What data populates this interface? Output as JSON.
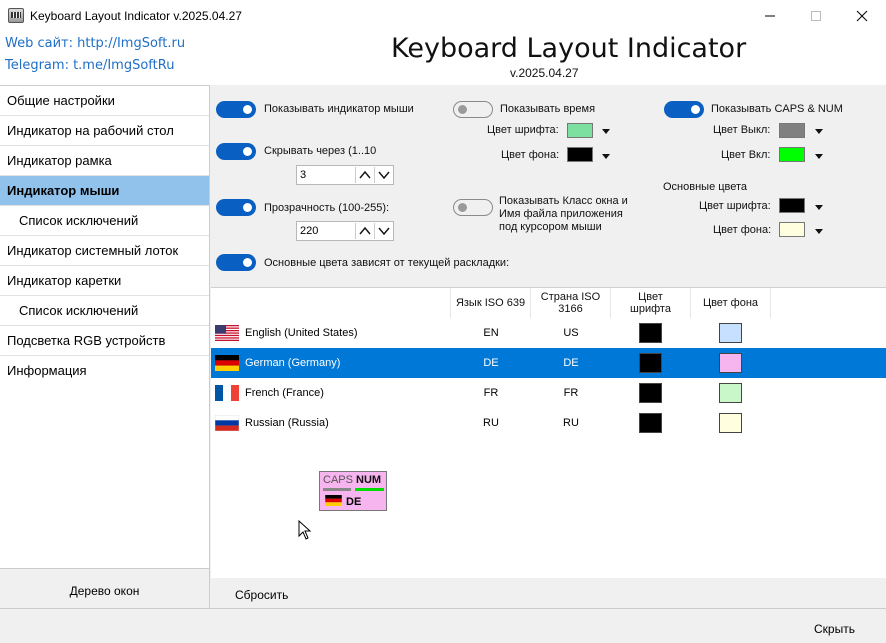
{
  "window": {
    "title": "Keyboard Layout Indicator v.2025.04.27",
    "minimize_icon": "minimize-icon",
    "maximize_icon": "maximize-icon",
    "close_icon": "close-icon"
  },
  "header": {
    "web_link": "Web сайт: http://ImgSoft.ru",
    "telegram_link": "Telegram: t.me/ImgSoftRu",
    "title": "Keyboard Layout Indicator",
    "version": "v.2025.04.27"
  },
  "sidebar": {
    "items": [
      {
        "label": "Общие настройки"
      },
      {
        "label": "Индикатор на рабочий стол"
      },
      {
        "label": "Индикатор рамка"
      },
      {
        "label": "Индикатор мыши"
      },
      {
        "label": "Список исключений"
      },
      {
        "label": "Индикатор системный лоток"
      },
      {
        "label": "Индикатор каретки"
      },
      {
        "label": "Список исключений"
      },
      {
        "label": "Подсветка RGB устройств"
      },
      {
        "label": "Информация"
      }
    ],
    "active_index": 3,
    "tree_button": "Дерево окон"
  },
  "settings": {
    "show_mouse_indicator": {
      "label": "Показывать индикатор мыши",
      "on": true
    },
    "hide_after": {
      "label": "Скрывать через (1..10",
      "on": true,
      "value": "3"
    },
    "transparency": {
      "label": "Прозрачность (100-255):",
      "on": true,
      "value": "220"
    },
    "colors_depend": {
      "label": "Основные цвета зависят от текущей раскладки:",
      "on": true
    },
    "show_time": {
      "label": "Показывать время",
      "on": false,
      "font_color_label": "Цвет шрифта:",
      "font_color": "#7ee0a0",
      "bg_color_label": "Цвет фона:",
      "bg_color": "#000000"
    },
    "show_class": {
      "line1": "Показывать Класс окна и",
      "line2": "Имя файла приложения",
      "line3": "под курсором мыши",
      "on": false
    },
    "show_caps": {
      "label": "Показывать CAPS & NUM",
      "on": true,
      "off_color_label": "Цвет Выкл:",
      "off_color": "#808080",
      "on_color_label": "Цвет Вкл:",
      "on_color": "#00ff00"
    },
    "main_colors": {
      "title": "Основные цвета",
      "font_color_label": "Цвет шрифта:",
      "font_color": "#000000",
      "bg_color_label": "Цвет фона:",
      "bg_color": "#ffffe0"
    }
  },
  "table": {
    "headers": {
      "lang": "Язык ISO 639",
      "country_l1": "Страна ISO",
      "country_l2": "3166",
      "font_l1": "Цвет",
      "font_l2": "шрифта",
      "bg": "Цвет фона"
    },
    "rows": [
      {
        "name": "English (United States)",
        "lang": "EN",
        "country": "US",
        "font_color": "#000000",
        "bg_color": "#c7e0ff",
        "flag": "us-flag-icon"
      },
      {
        "name": "German (Germany)",
        "lang": "DE",
        "country": "DE",
        "font_color": "#000000",
        "bg_color": "#f6b5ef",
        "flag": "de-flag-icon",
        "selected": true
      },
      {
        "name": "French (France)",
        "lang": "FR",
        "country": "FR",
        "font_color": "#000000",
        "bg_color": "#c9f7c9",
        "flag": "fr-flag-icon"
      },
      {
        "name": "Russian (Russia)",
        "lang": "RU",
        "country": "RU",
        "font_color": "#000000",
        "bg_color": "#ffffe0",
        "flag": "ru-flag-icon"
      }
    ]
  },
  "preview": {
    "caps": "CAPS",
    "num": "NUM",
    "lang": "DE"
  },
  "buttons": {
    "reset": "Сбросить",
    "hide": "Скрыть"
  }
}
